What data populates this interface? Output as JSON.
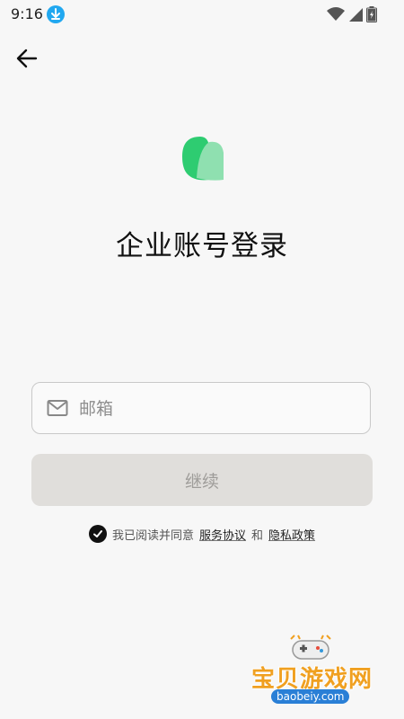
{
  "status_bar": {
    "time": "9:16"
  },
  "page": {
    "title": "企业账号登录"
  },
  "email": {
    "placeholder": "邮箱",
    "value": ""
  },
  "continue_label": "继续",
  "agreement": {
    "prefix": "我已阅读并同意",
    "terms": "服务协议",
    "and": "和",
    "privacy": "隐私政策"
  },
  "watermark": {
    "name": "宝贝游戏网",
    "url": "baobeiy.com"
  },
  "colors": {
    "accent_green": "#2ecc71",
    "accent_green_light": "#8fe0b0",
    "button_disabled_bg": "#e0dedb",
    "button_disabled_text": "#9f9d9a"
  }
}
